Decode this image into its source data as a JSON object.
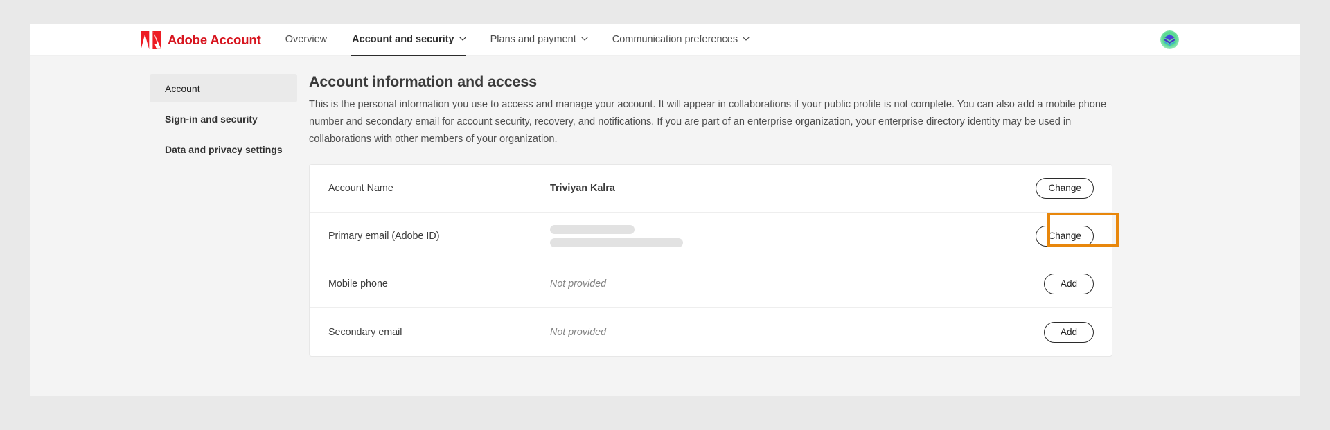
{
  "header": {
    "brand_name": "Adobe Account",
    "logo_icon": "adobe-logo-icon",
    "avatar_icon": "user-avatar-icon",
    "nav": [
      {
        "label": "Overview",
        "has_caret": false,
        "active": false
      },
      {
        "label": "Account and security",
        "has_caret": true,
        "active": true
      },
      {
        "label": "Plans and payment",
        "has_caret": true,
        "active": false
      },
      {
        "label": "Communication preferences",
        "has_caret": true,
        "active": false
      }
    ]
  },
  "sidebar": {
    "items": [
      {
        "label": "Account",
        "selected": true
      },
      {
        "label": "Sign-in and security",
        "selected": false
      },
      {
        "label": "Data and privacy settings",
        "selected": false
      }
    ]
  },
  "main": {
    "title": "Account information and access",
    "description": "This is the personal information you use to access and manage your account. It will appear in collaborations if your public profile is not complete. You can also add a mobile phone number and secondary email for account security, recovery, and notifications. If you are part of an enterprise organization, your enterprise directory identity may be used in collaborations with other members of your organization.",
    "rows": [
      {
        "label": "Account Name",
        "value": "Triviyan Kalra",
        "value_type": "text",
        "action_label": "Change",
        "highlighted": true
      },
      {
        "label": "Primary email (Adobe ID)",
        "value": "",
        "value_type": "redacted",
        "action_label": "Change",
        "highlighted": false
      },
      {
        "label": "Mobile phone",
        "value": "Not provided",
        "value_type": "muted",
        "action_label": "Add",
        "highlighted": false
      },
      {
        "label": "Secondary email",
        "value": "Not provided",
        "value_type": "muted",
        "action_label": "Add",
        "highlighted": false
      }
    ]
  },
  "colors": {
    "brand_red": "#d7151f",
    "highlight_orange": "#e8870c",
    "page_background": "#f4f4f4",
    "outer_background": "#e9e9e9"
  }
}
